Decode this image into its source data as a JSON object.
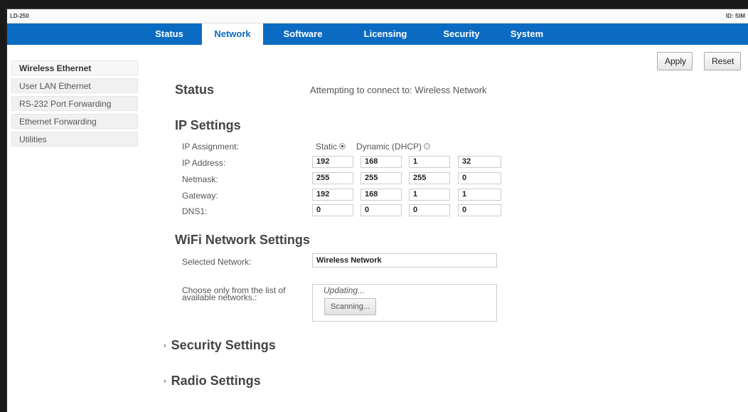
{
  "window": {
    "model": "LD-250",
    "device_id": "ID: SIM"
  },
  "nav": {
    "tabs": [
      {
        "label": "Status"
      },
      {
        "label": "Network"
      },
      {
        "label": "Software"
      },
      {
        "label": "Licensing"
      },
      {
        "label": "Security"
      },
      {
        "label": "System"
      }
    ],
    "active": "Network"
  },
  "sidebar": {
    "items": [
      {
        "label": "Wireless Ethernet"
      },
      {
        "label": "User LAN Ethernet"
      },
      {
        "label": "RS-232 Port Forwarding"
      },
      {
        "label": "Ethernet Forwarding"
      },
      {
        "label": "Utilities"
      }
    ],
    "active": "Wireless Ethernet"
  },
  "toolbar": {
    "apply_label": "Apply",
    "reset_label": "Reset"
  },
  "status": {
    "heading": "Status",
    "text": "Attempting to connect to: Wireless Network"
  },
  "ip_settings": {
    "heading": "IP Settings",
    "assignment_label": "IP Assignment:",
    "static_label": "Static",
    "dhcp_label": "Dynamic (DHCP)",
    "selected": "Static",
    "ip_label": "IP Address:",
    "ip": [
      "192",
      "168",
      "1",
      "32"
    ],
    "netmask_label": "Netmask:",
    "netmask": [
      "255",
      "255",
      "255",
      "0"
    ],
    "gateway_label": "Gateway:",
    "gateway": [
      "192",
      "168",
      "1",
      "1"
    ],
    "dns_label": "DNS1:",
    "dns": [
      "0",
      "0",
      "0",
      "0"
    ]
  },
  "wifi": {
    "heading": "WiFi Network Settings",
    "selected_label": "Selected Network:",
    "selected_value": "Wireless Network",
    "choose_label": "Choose only from the list of available networks.:",
    "updating_text": "Updating...",
    "scan_label": "Scanning..."
  },
  "sections": {
    "security": "Security Settings",
    "radio": "Radio Settings"
  },
  "colors": {
    "nav_bg": "#0b6bc2",
    "nav_text": "#ffffff"
  }
}
